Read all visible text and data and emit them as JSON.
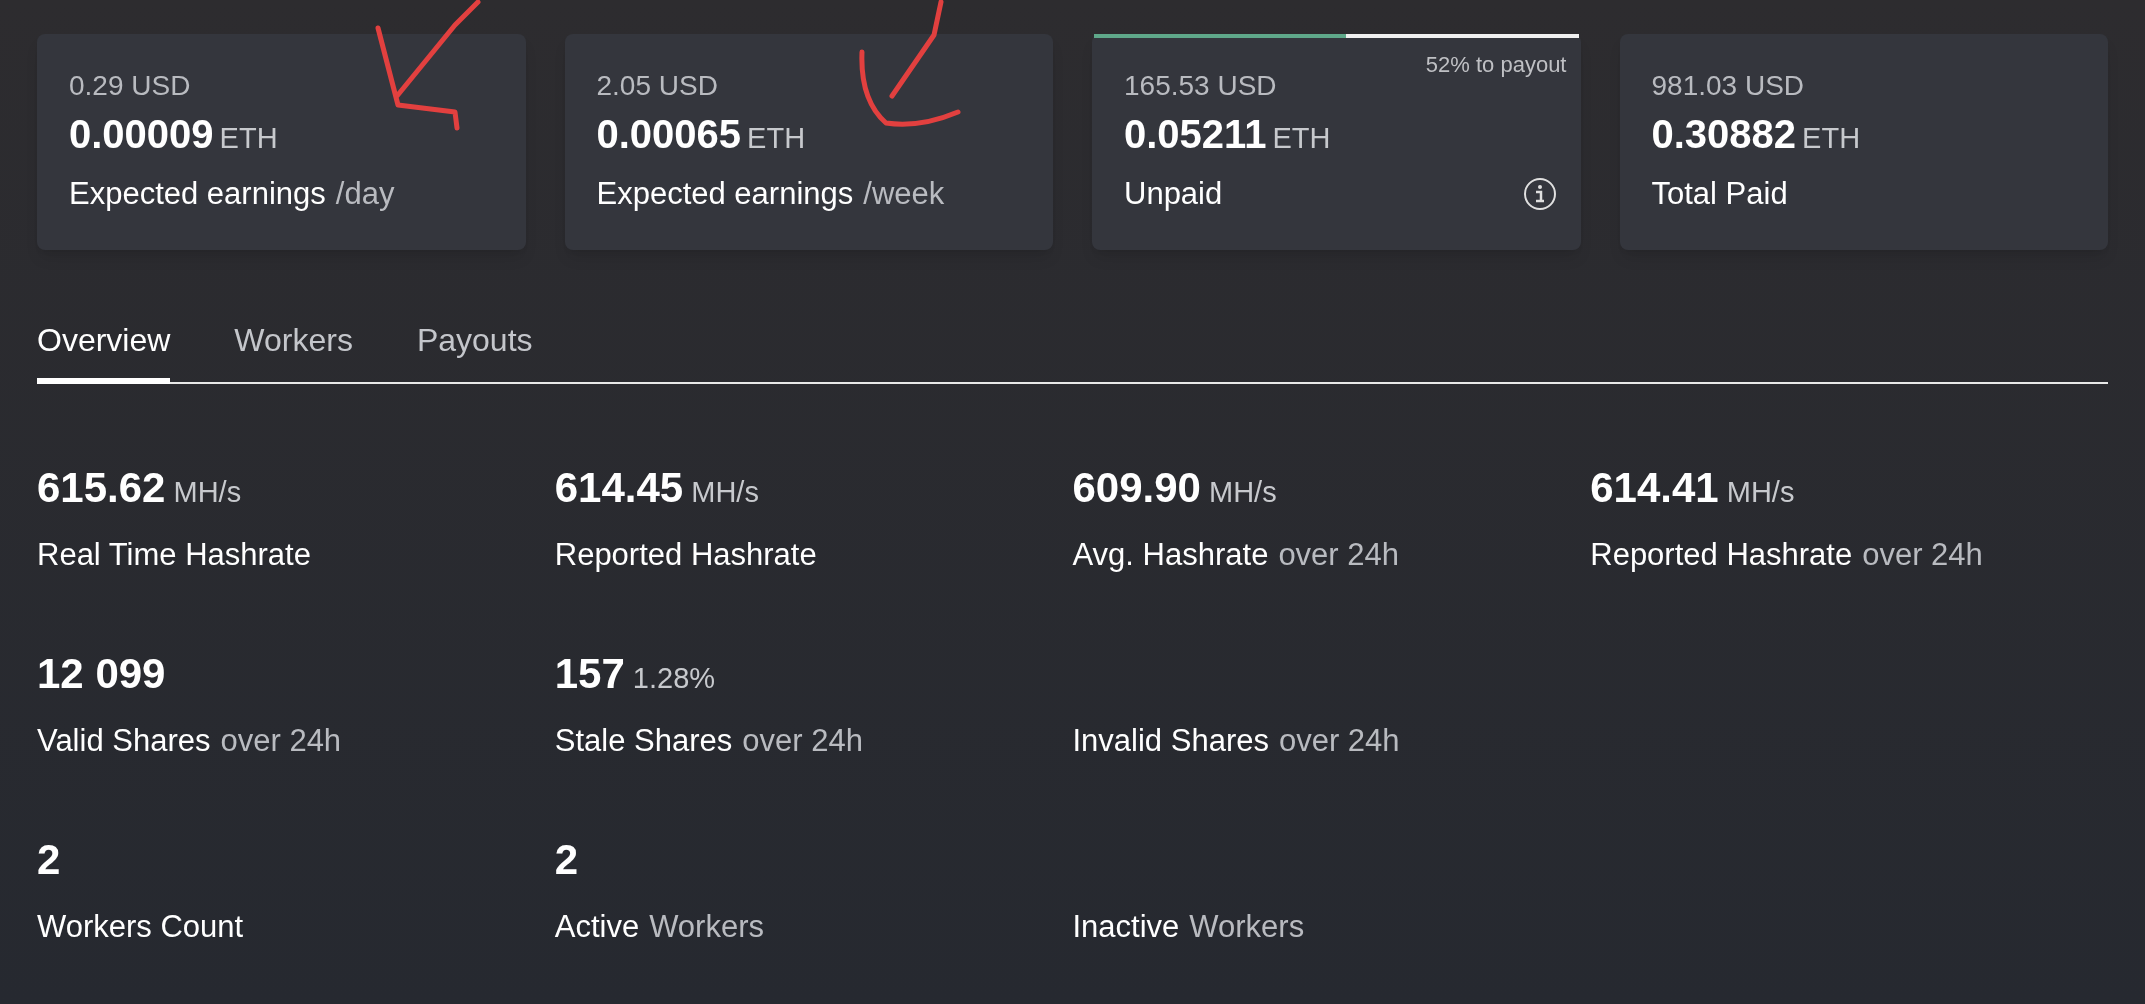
{
  "cards": [
    {
      "usd": "0.29 USD",
      "amount": "0.00009",
      "unit": "ETH",
      "label": "Expected earnings",
      "suffix": "/day"
    },
    {
      "usd": "2.05 USD",
      "amount": "0.00065",
      "unit": "ETH",
      "label": "Expected earnings",
      "suffix": "/week"
    },
    {
      "usd": "165.53 USD",
      "amount": "0.05211",
      "unit": "ETH",
      "label": "Unpaid",
      "progress": {
        "level": 0.52,
        "text": "52% to payout"
      },
      "info": true
    },
    {
      "usd": "981.03 USD",
      "amount": "0.30882",
      "unit": "ETH",
      "label": "Total Paid"
    }
  ],
  "tabs": [
    {
      "label": "Overview",
      "selected": true
    },
    {
      "label": "Workers",
      "selected": false
    },
    {
      "label": "Payouts",
      "selected": false
    }
  ],
  "stats": [
    [
      {
        "value": "615.62",
        "unit": "MH/s",
        "label": "Real Time Hashrate"
      },
      {
        "value": "614.45",
        "unit": "MH/s",
        "label": "Reported Hashrate"
      },
      {
        "value": "609.90",
        "unit": "MH/s",
        "label": "Avg. Hashrate",
        "suffix": "over 24h"
      },
      {
        "value": "614.41",
        "unit": "MH/s",
        "label": "Reported Hashrate",
        "suffix": "over 24h"
      }
    ],
    [
      {
        "value": "12 099",
        "label": "Valid Shares",
        "suffix": "over 24h"
      },
      {
        "value": "157",
        "unit": "1.28%",
        "label": "Stale Shares",
        "suffix": "over 24h"
      },
      {
        "label": "Invalid Shares",
        "suffix": "over 24h"
      }
    ],
    [
      {
        "value": "2",
        "label": "Workers Count"
      },
      {
        "value": "2",
        "label": "Active",
        "suffix": "Workers"
      },
      {
        "label": "Inactive",
        "suffix": "Workers"
      }
    ]
  ]
}
